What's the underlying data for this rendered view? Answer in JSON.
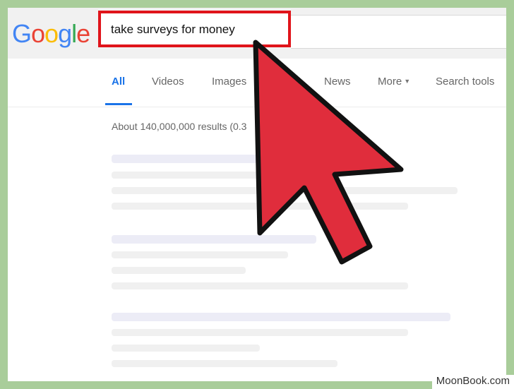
{
  "search": {
    "logo": [
      "G",
      "o",
      "o",
      "g",
      "l",
      "e"
    ],
    "logo_colors": [
      "#4285f4",
      "#ea4335",
      "#fbbc05",
      "#4285f4",
      "#34a853",
      "#ea4335"
    ],
    "query": "take surveys for money",
    "highlight_color": "#e0141b"
  },
  "tabs": [
    {
      "label": "All",
      "active": true
    },
    {
      "label": "Videos"
    },
    {
      "label": "Images"
    },
    {
      "label": "News"
    },
    {
      "label": "More"
    },
    {
      "label": "Search tools"
    }
  ],
  "results": {
    "stats": "About 140,000,000 results (0.3"
  },
  "overlay": {
    "cursor_color": "#e02d3c",
    "watermark": "MoonBook.com"
  }
}
